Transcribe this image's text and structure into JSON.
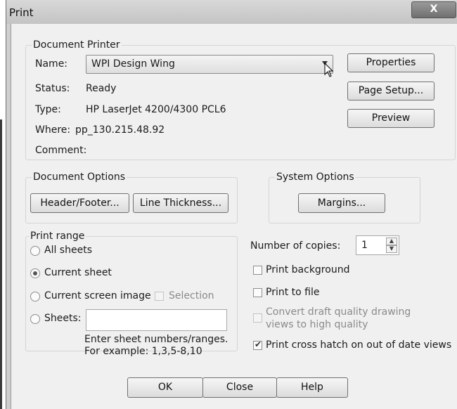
{
  "window": {
    "title": "Print",
    "close_glyph": "X"
  },
  "document_printer": {
    "label": "Document Printer",
    "name_label": "Name:",
    "name_value": "WPI Design Wing",
    "status_label": "Status:",
    "status_value": "Ready",
    "type_label": "Type:",
    "type_value": "HP LaserJet 4200/4300 PCL6",
    "where_label": "Where:",
    "where_value": "pp_130.215.48.92",
    "comment_label": "Comment:",
    "properties_button": "Properties",
    "page_setup_button": "Page Setup...",
    "preview_button": "Preview"
  },
  "document_options": {
    "label": "Document Options",
    "header_footer_button": "Header/Footer...",
    "line_thickness_button": "Line Thickness..."
  },
  "system_options": {
    "label": "System Options",
    "margins_button": "Margins..."
  },
  "print_range": {
    "label": "Print range",
    "all_sheets": "All sheets",
    "current_sheet": "Current sheet",
    "current_screen_image": "Current screen image",
    "selection": "Selection",
    "sheets": "Sheets:",
    "sheets_value": "",
    "hint_line1": "Enter sheet numbers/ranges.",
    "hint_line2": "For example: 1,3,5-8,10",
    "selected": "current_sheet"
  },
  "copies": {
    "label": "Number of copies:",
    "value": "1"
  },
  "options": {
    "print_background": "Print background",
    "print_to_file": "Print to file",
    "convert_line1": "Convert draft quality drawing",
    "convert_line2": "views to high quality",
    "cross_hatch": "Print cross hatch on out of date views",
    "print_background_checked": false,
    "print_to_file_checked": false,
    "convert_checked": false,
    "convert_enabled": false,
    "cross_hatch_checked": true
  },
  "footer": {
    "ok_button": "OK",
    "close_button": "Close",
    "help_button": "Help"
  }
}
